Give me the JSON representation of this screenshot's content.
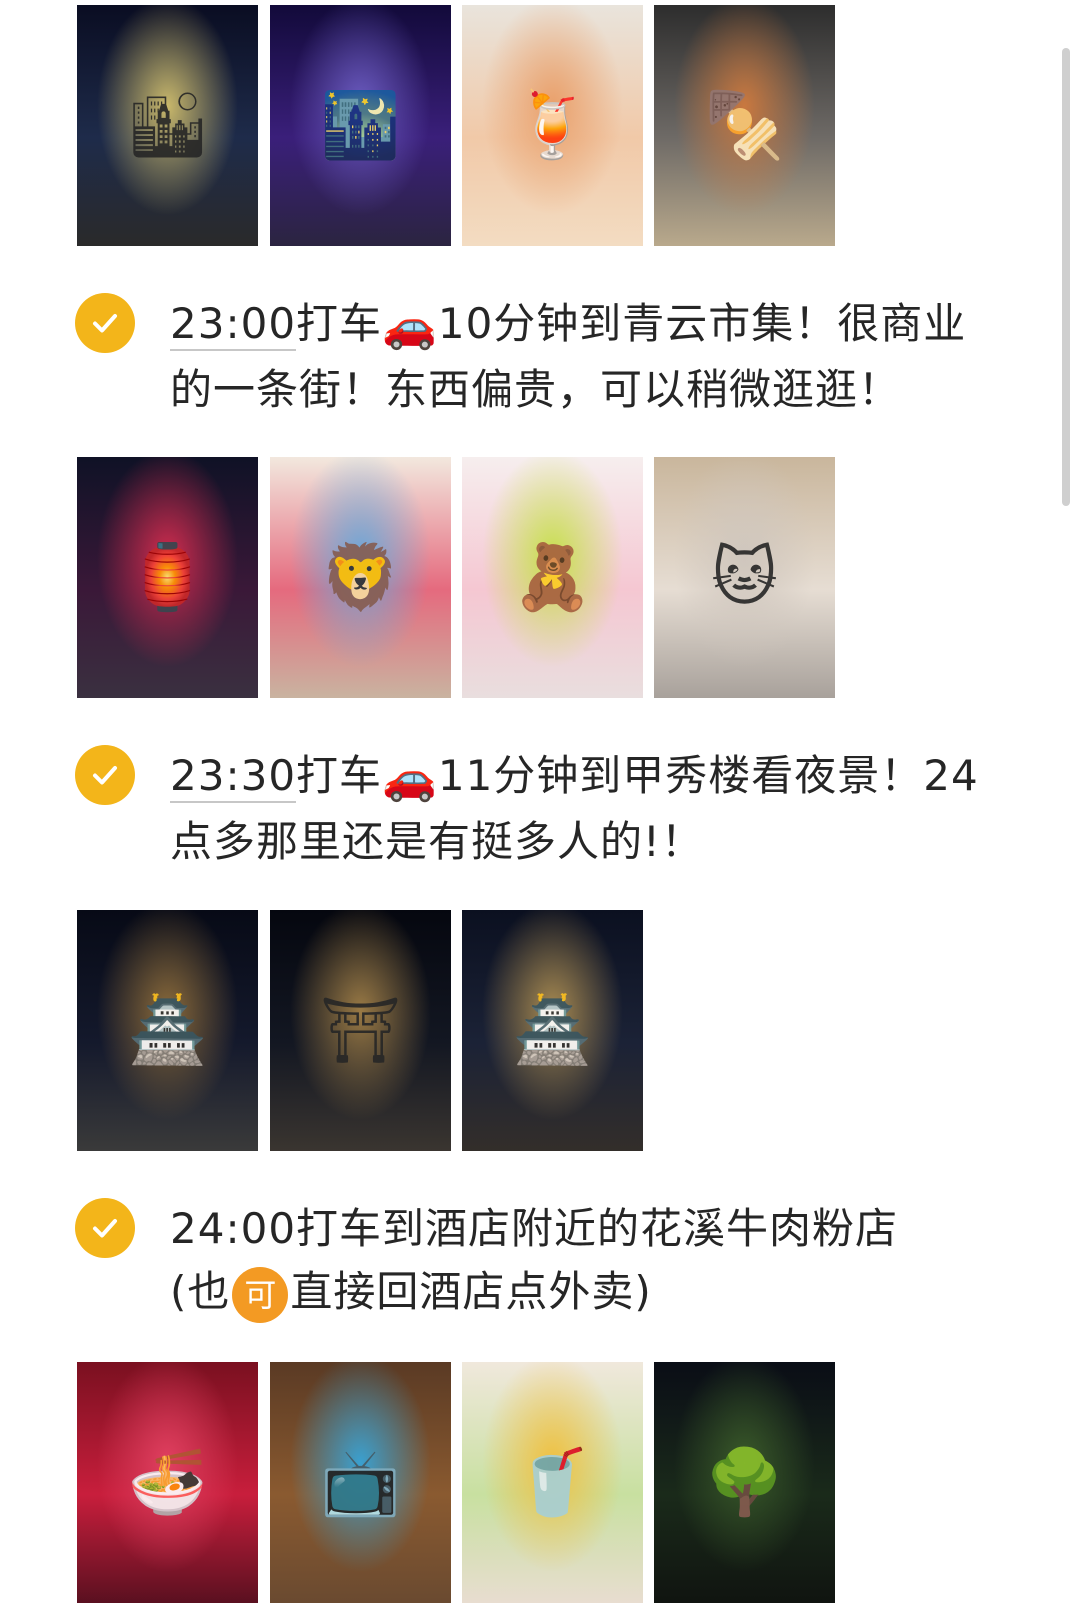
{
  "sections": [
    {
      "photos": [
        {
          "icon": "night-street-photo",
          "glyph": "🏙",
          "colors": [
            "#0a0d22",
            "#1e2b4a",
            "#c9b86b",
            "#2a2a2a"
          ]
        },
        {
          "icon": "neon-street-photo",
          "glyph": "🌃",
          "colors": [
            "#120a3a",
            "#3a1f7a",
            "#6b5cc0",
            "#2b2440"
          ]
        },
        {
          "icon": "cocktail-drinks-photo",
          "glyph": "🍹",
          "colors": [
            "#e9e4dc",
            "#f1c9a8",
            "#e9a06b",
            "#f3dcc2"
          ]
        },
        {
          "icon": "grill-food-photo",
          "glyph": "🍢",
          "colors": [
            "#2d2d2d",
            "#6e6a66",
            "#c9783f",
            "#b9a98c"
          ]
        }
      ]
    },
    {
      "check_icon": "check-circle-icon",
      "time": "23:00",
      "text_before_car": "打车",
      "car_icon": "🚗",
      "text_after_car": "10分钟到青云市集！很商业的一条街！东西偏贵，可以稍微逛逛！",
      "photos": [
        {
          "icon": "market-street-photo",
          "glyph": "🏮",
          "colors": [
            "#0f1226",
            "#3a1838",
            "#d12c4e",
            "#3a3040"
          ]
        },
        {
          "icon": "lion-toys-photo",
          "glyph": "🦁",
          "colors": [
            "#f2e8de",
            "#e56a7e",
            "#6aa9d9",
            "#c9b3a0"
          ]
        },
        {
          "icon": "plush-shop-photo",
          "glyph": "🧸",
          "colors": [
            "#f6eeee",
            "#f5c7d2",
            "#c6e04a",
            "#e9dede"
          ]
        },
        {
          "icon": "cat-photo",
          "glyph": "🐱",
          "colors": [
            "#c9b69c",
            "#e6ddd3",
            "#cfc6bd",
            "#a8a19b"
          ]
        }
      ]
    },
    {
      "check_icon": "check-circle-icon",
      "time": "23:30",
      "text_before_car": "打车",
      "car_icon": "🚗",
      "text_after_car": "11分钟到甲秀楼看夜景！24点多那里还是有挺多人的!！",
      "photos": [
        {
          "icon": "jiaxiu-pavilion-photo",
          "glyph": "🏯",
          "colors": [
            "#070a16",
            "#14192c",
            "#8a6a3a",
            "#3a3a3a"
          ]
        },
        {
          "icon": "pavilion-gate-photo",
          "glyph": "⛩",
          "colors": [
            "#05070f",
            "#131722",
            "#9a7a45",
            "#3a3530"
          ]
        },
        {
          "icon": "pavilion-night-photo",
          "glyph": "🏯",
          "colors": [
            "#0b1020",
            "#1b2236",
            "#a88a50",
            "#332e2a"
          ]
        }
      ]
    },
    {
      "check_icon": "check-circle-icon",
      "line1": "24:00打车到酒店附近的花溪牛肉粉店",
      "line2_open": "(也",
      "ke_badge": "可",
      "line2_rest": "直接回酒店点外卖)",
      "photos": [
        {
          "icon": "noodle-shop-menu-photo",
          "glyph": "🍜",
          "colors": [
            "#7a1020",
            "#c81e3c",
            "#e04060",
            "#5a1020"
          ]
        },
        {
          "icon": "tv-screen-photo",
          "glyph": "📺",
          "colors": [
            "#5a3a24",
            "#8a5a30",
            "#3aa0d0",
            "#6a4a30"
          ]
        },
        {
          "icon": "yogurt-drinks-photo",
          "glyph": "🥤",
          "colors": [
            "#f0e8dc",
            "#c8e0a0",
            "#f0c040",
            "#e8ddd0"
          ]
        },
        {
          "icon": "night-tree-photo",
          "glyph": "🌳",
          "colors": [
            "#0a0d16",
            "#1a2a1a",
            "#3a5a2a",
            "#101410"
          ]
        }
      ]
    }
  ]
}
